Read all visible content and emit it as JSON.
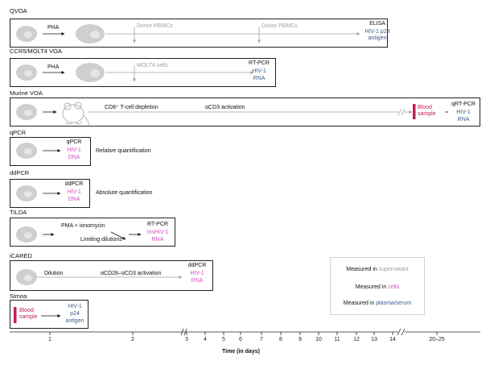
{
  "panels": {
    "qvoa": {
      "title": "QVOA",
      "pha": "PHA",
      "donor1": "Donor PBMCs",
      "donor2": "Donor PBMCs",
      "method": "ELISA",
      "target": "HIV-1 p24 antigen"
    },
    "ccr5": {
      "title": "CCR5/MOLT4 VOA",
      "pha": "PHA",
      "molt": "MOLT4 cells",
      "method": "RT-PCR",
      "target1": "HIV-1",
      "target2": "RNA"
    },
    "murine": {
      "title": "Murine VOA",
      "depletion": "CD8⁺ T-cell depletion",
      "activation": "αCD3 activation",
      "blood": "Blood sample",
      "method": "qRT-PCR",
      "target1": "HIV-1",
      "target2": "RNA"
    },
    "qpcr": {
      "title": "qPCR",
      "method": "qPCR",
      "target1": "HIV-1",
      "target2": "DNA",
      "note": "Relative quantification"
    },
    "ddpcr": {
      "title": "ddPCR",
      "method": "ddPCR",
      "target1": "HIV-1",
      "target2": "DNA",
      "note": "Absolute quantification"
    },
    "tilda": {
      "title": "TILDA",
      "stim": "PMA + ionomycin",
      "dilution": "Limiting dilutions",
      "method": "RT-PCR",
      "target1": "msHIV-1",
      "target2": "RNA"
    },
    "icared": {
      "title": "iCARED",
      "dilution": "Dilution",
      "activation": "αCD28–αCD3 activation",
      "method": "ddPCR",
      "target1": "HIV-1",
      "target2": "RNA"
    },
    "simoa": {
      "title": "Simoa",
      "blood": "Blood sample",
      "target1": "HIV-1",
      "target2": "p24",
      "target3": "antigen"
    }
  },
  "legend": {
    "prefix": "Measured in",
    "supernatant": "supernatant",
    "cells": "cells",
    "plasma": "plasma/serum",
    "supernatant_color": "#a0a0a0",
    "cells_color": "#d84fc3",
    "plasma_color": "#3d5a8c"
  },
  "axis": {
    "label": "Time (in days)",
    "ticks": [
      "1",
      "2",
      "3",
      "4",
      "5",
      "6",
      "7",
      "8",
      "9",
      "10",
      "11",
      "12",
      "13",
      "14",
      "20–25"
    ]
  },
  "colors": {
    "blood": "#c4214f",
    "line": "#a0a0a0",
    "cell": "#cfcfcf"
  }
}
